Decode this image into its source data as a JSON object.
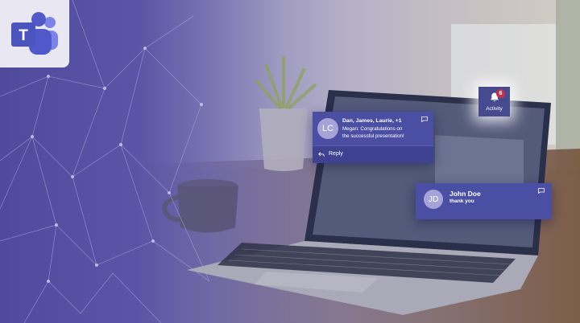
{
  "activity": {
    "label": "Activity",
    "badge_count": "6"
  },
  "notification_primary": {
    "initials": "LC",
    "participants": "Dan, James, Laurie, +1",
    "message_line1": "Megan: Congratulations on",
    "message_line2": "the successful presentation!",
    "reply_label": "Reply"
  },
  "notification_secondary": {
    "initials": "JD",
    "sender": "John Doe",
    "message": "thank you"
  },
  "colors": {
    "teams_purple": "#4b4fa3",
    "badge_red": "#c4314b",
    "avatar": "#a6a3d9"
  },
  "icons": [
    "teams-logo-icon",
    "bell-icon",
    "chat-icon",
    "reply-icon"
  ]
}
